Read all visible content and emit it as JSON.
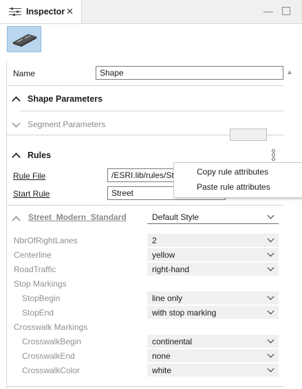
{
  "tab": {
    "title": "Inspector",
    "icon": "sliders-icon"
  },
  "window": {
    "minimize_icon": "minimize-icon",
    "maximize_icon": "maximize-icon"
  },
  "name_field": {
    "label": "Name",
    "value": "Shape"
  },
  "sections": {
    "shape_parameters": "Shape Parameters",
    "segment_parameters": "Segment Parameters",
    "rules": "Rules"
  },
  "rule_file": {
    "label": "Rule File",
    "value": "/ESRI.lib/rules/Str"
  },
  "start_rule": {
    "label": "Start Rule",
    "value": "Street"
  },
  "style": {
    "label": "Street_Modern_Standard",
    "value": "Default Style"
  },
  "attributes": [
    {
      "label": "NbrOfRightLanes",
      "value": "2"
    },
    {
      "label": "Centerline",
      "value": "yellow"
    },
    {
      "label": "RoadTraffic",
      "value": "right-hand"
    }
  ],
  "stop_markings": {
    "group": "Stop Markings",
    "items": [
      {
        "label": "StopBegin",
        "value": "line only"
      },
      {
        "label": "StopEnd",
        "value": "with stop marking"
      }
    ]
  },
  "crosswalk_markings": {
    "group": "Crosswalk Markings",
    "items": [
      {
        "label": "CrosswalkBegin",
        "value": "continental"
      },
      {
        "label": "CrosswalkEnd",
        "value": "none"
      },
      {
        "label": "CrosswalkColor",
        "value": "white"
      }
    ]
  },
  "context_menu": {
    "items": [
      "Copy rule attributes",
      "Paste rule attributes"
    ]
  },
  "colors": {
    "accent": "#0078d7",
    "preview_bg": "#b9d6ee"
  }
}
